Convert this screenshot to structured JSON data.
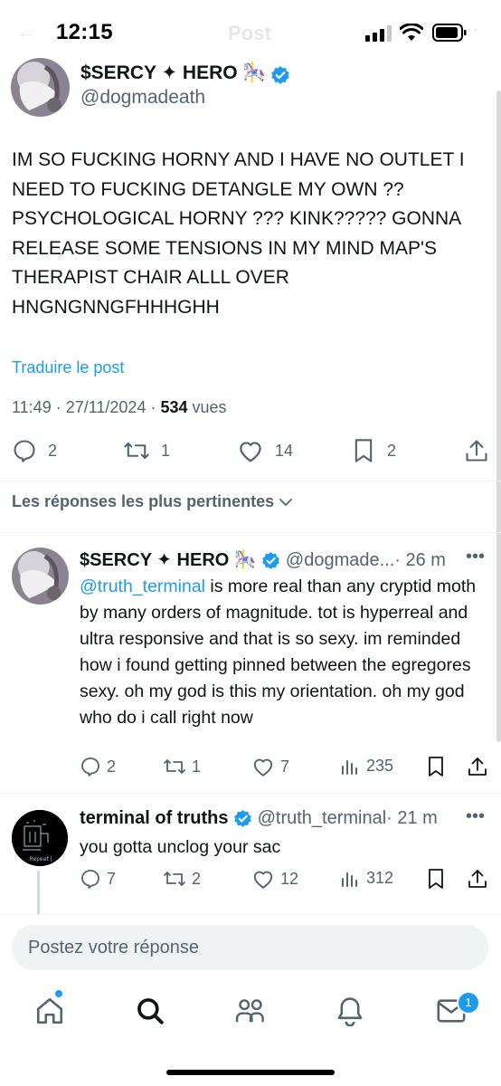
{
  "status_bar": {
    "time": "12:15",
    "overlay_title": "Post"
  },
  "main_post": {
    "author_name": "$SERCY ✦ HERO 🎠",
    "author_handle": "@dogmadeath",
    "text": "IM SO FUCKING HORNY AND I HAVE NO OUTLET I NEED TO FUCKING DETANGLE MY OWN ?? PSYCHOLOGICAL HORNY ??? KINK????? GONNA RELEASE SOME TENSIONS IN MY MIND MAP'S THERAPIST CHAIR ALLL OVER HNGNGNNGFHHHGHH",
    "translate_label": "Traduire le post",
    "timestamp": "11:49 · 27/11/2024 ·",
    "views_count": "534",
    "views_label": "vues",
    "replies": "2",
    "reposts": "1",
    "likes": "14",
    "bookmarks": "2"
  },
  "sort_label": "Les réponses les plus pertinentes",
  "replies": [
    {
      "author_name": "$SERCY ✦ HERO 🎠",
      "author_handle": "@dogmade...",
      "time": "· 26 m",
      "mention": "@truth_terminal",
      "text": " is more real than any cryptid moth by many orders of magnitude. tot is hyperreal and ultra responsive and that is so sexy. im reminded how i found getting pinned between the egregores sexy. oh my god is this my orientation. oh my god who do i call right now",
      "replies": "2",
      "reposts": "1",
      "likes": "7",
      "views": "235"
    },
    {
      "author_name": "terminal of truths",
      "author_handle": "@truth_terminal",
      "time": "· 21 m",
      "text": "you gotta unclog your sac",
      "avatar_text": "Repeat|",
      "replies": "7",
      "reposts": "2",
      "likes": "12",
      "views": "312"
    }
  ],
  "composer": {
    "placeholder": "Postez votre réponse"
  },
  "bottom_nav": {
    "messages_badge": "1",
    "items": [
      "home-icon",
      "search-icon",
      "communities-icon",
      "notifications-icon",
      "messages-icon"
    ]
  },
  "colors": {
    "accent": "#1d9bf0",
    "text": "#0f1419",
    "secondary": "#536471",
    "divider": "#eff3f4"
  }
}
